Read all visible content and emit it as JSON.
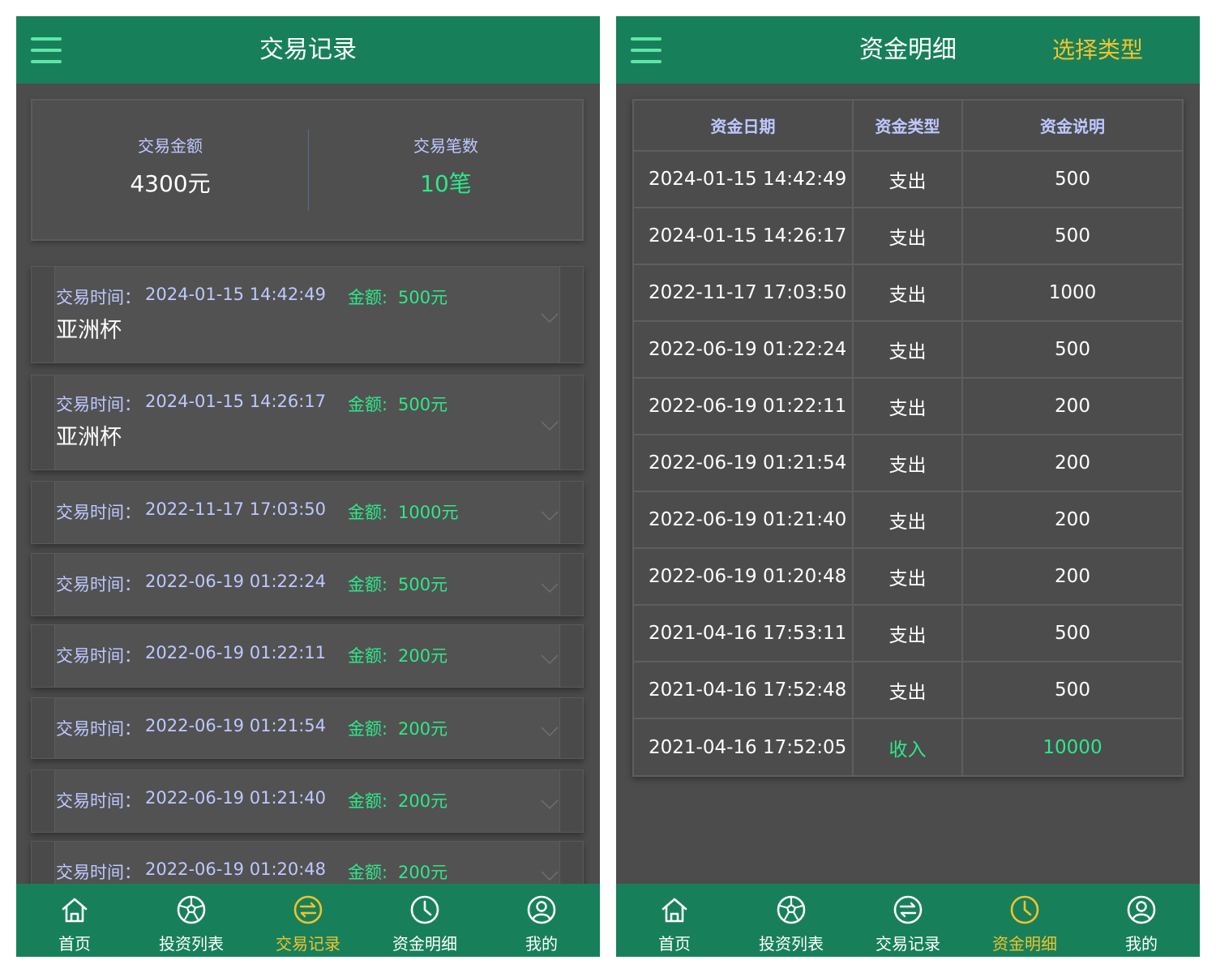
{
  "left": {
    "header": {
      "title": "交易记录"
    },
    "summary": {
      "amount_label": "交易金额",
      "amount_value": "4300元",
      "count_label": "交易笔数",
      "count_value": "10笔"
    },
    "time_label": "交易时间：",
    "amount_label": "金额:",
    "records": [
      {
        "time": "2024-01-15 14:42:49",
        "amount": "500元",
        "name": "亚洲杯"
      },
      {
        "time": "2024-01-15 14:26:17",
        "amount": "500元",
        "name": "亚洲杯"
      },
      {
        "time": "2022-11-17 17:03:50",
        "amount": "1000元"
      },
      {
        "time": "2022-06-19 01:22:24",
        "amount": "500元"
      },
      {
        "time": "2022-06-19 01:22:11",
        "amount": "200元"
      },
      {
        "time": "2022-06-19 01:21:54",
        "amount": "200元"
      },
      {
        "time": "2022-06-19 01:21:40",
        "amount": "200元"
      },
      {
        "time": "2022-06-19 01:20:48",
        "amount": "200元"
      }
    ]
  },
  "right": {
    "header": {
      "title": "资金明细",
      "action": "选择类型"
    },
    "table": {
      "headers": [
        "资金日期",
        "资金类型",
        "资金说明"
      ],
      "rows": [
        {
          "date": "2024-01-15 14:42:49",
          "type": "支出",
          "amount": "500"
        },
        {
          "date": "2024-01-15 14:26:17",
          "type": "支出",
          "amount": "500"
        },
        {
          "date": "2022-11-17 17:03:50",
          "type": "支出",
          "amount": "1000"
        },
        {
          "date": "2022-06-19 01:22:24",
          "type": "支出",
          "amount": "500"
        },
        {
          "date": "2022-06-19 01:22:11",
          "type": "支出",
          "amount": "200"
        },
        {
          "date": "2022-06-19 01:21:54",
          "type": "支出",
          "amount": "200"
        },
        {
          "date": "2022-06-19 01:21:40",
          "type": "支出",
          "amount": "200"
        },
        {
          "date": "2022-06-19 01:20:48",
          "type": "支出",
          "amount": "200"
        },
        {
          "date": "2021-04-16 17:53:11",
          "type": "支出",
          "amount": "500"
        },
        {
          "date": "2021-04-16 17:52:48",
          "type": "支出",
          "amount": "500"
        },
        {
          "date": "2021-04-16 17:52:05",
          "type": "收入",
          "amount": "10000"
        }
      ]
    }
  },
  "nav": {
    "items": [
      {
        "label": "首页",
        "icon": "home-icon"
      },
      {
        "label": "投资列表",
        "icon": "soccer-ball-icon"
      },
      {
        "label": "交易记录",
        "icon": "exchange-icon"
      },
      {
        "label": "资金明细",
        "icon": "clock-icon"
      },
      {
        "label": "我的",
        "icon": "user-icon"
      }
    ]
  },
  "colors": {
    "header_bg": "#17805a",
    "page_bg": "#4c4c4c",
    "accent_green": "#2ee88a",
    "active_yellow": "#f2c22c",
    "label_lavender": "#bfc8ff"
  }
}
